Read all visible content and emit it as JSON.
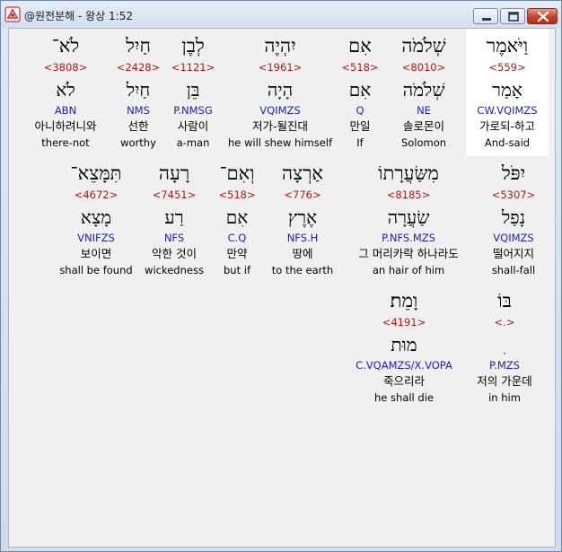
{
  "window": {
    "title": "@원전분해 - 왕상 1:52",
    "buttons": [
      "minimize-icon",
      "maximize-icon",
      "close-icon"
    ],
    "colors": {
      "hebrew": "#000000",
      "strong": "#b01818",
      "morph": "#1f1fa8",
      "highlight": "#ffffff"
    }
  },
  "rows": [
    [
      {
        "heb": "וַיֹּאמֶר",
        "strong": "<559>",
        "lemma": "אָמַר",
        "morph": "CW.VQIMZS",
        "ko": "가로되-하고",
        "en": "And-said",
        "highlight": true
      },
      {
        "heb": "שְׁלֹמֹה",
        "strong": "<8010>",
        "lemma": "שְׁלֹמֹה",
        "morph": "NE",
        "ko": "솔로몬이",
        "en": "Solomon"
      },
      {
        "heb": "אִם",
        "strong": "<518>",
        "lemma": "אִם",
        "morph": "Q",
        "ko": "만일",
        "en": "If"
      },
      {
        "heb": "יִהְיֶה",
        "strong": "<1961>",
        "lemma": "הָיָה",
        "morph": "VQIMZS",
        "ko": "저가-될진대",
        "en": "he will shew himself"
      },
      {
        "heb": "לְבֶן",
        "strong": "<1121>",
        "lemma": "בֵּן",
        "morph": "P.NMSG",
        "ko": "사람이",
        "en": "a-man"
      },
      {
        "heb": "חַיִל",
        "strong": "<2428>",
        "lemma": "חַיִל",
        "morph": "NMS",
        "ko": "선한",
        "en": "worthy"
      },
      {
        "heb": "לֹא־",
        "strong": "<3808>",
        "lemma": "לֹא",
        "morph": "ABN",
        "ko": "아니하려니와",
        "en": "there-not"
      }
    ],
    [
      {
        "heb": "יִפֹּל",
        "strong": "<5307>",
        "lemma": "נָפַל",
        "morph": "VQIMZS",
        "ko": "떨어지지",
        "en": "shall-fall"
      },
      {
        "heb": "מִשַּׂעֲרָתוֹ",
        "strong": "<8185>",
        "lemma": "שַׂעֲרָה",
        "morph": "P.NFS.MZS",
        "ko": "그 머리카락 하나라도",
        "en": "an hair of him"
      },
      {
        "heb": "אַרְצָה",
        "strong": "<776>",
        "lemma": "אֶרֶץ",
        "morph": "NFS.H",
        "ko": "땅에",
        "en": "to the earth"
      },
      {
        "heb": "וְאִם־",
        "strong": "<518>",
        "lemma": "אִם",
        "morph": "C.Q",
        "ko": "만약",
        "en": "but if"
      },
      {
        "heb": "רָעָה",
        "strong": "<7451>",
        "lemma": "רַע",
        "morph": "NFS",
        "ko": "악한 것이",
        "en": "wickedness"
      },
      {
        "heb": "תִּמָּצֵא־",
        "strong": "<4672>",
        "lemma": "מָצָא",
        "morph": "VNIFZS",
        "ko": "보이면",
        "en": "shall be found"
      }
    ],
    [
      {
        "heb": "בּוֹ",
        "strong": "<.>",
        "lemma": "ִ",
        "morph": "P.MZS",
        "ko": "저의 가운데",
        "en": "in him"
      },
      {
        "heb": "וָמֵת׃",
        "strong": "<4191>",
        "lemma": "מוּת",
        "morph": "C.VQAMZS/X.VOPA",
        "ko": "죽으리라",
        "en": "he shall die"
      }
    ]
  ]
}
